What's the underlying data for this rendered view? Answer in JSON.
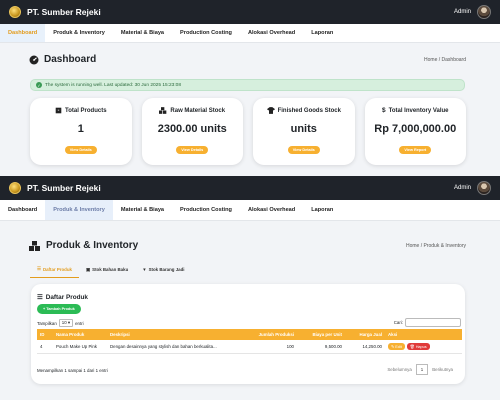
{
  "app": {
    "brand": "PT. Sumber Rejeki",
    "user": "Admin"
  },
  "menu": [
    "Dashboard",
    "Produk & Inventory",
    "Material & Biaya",
    "Production Costing",
    "Alokasi Overhead",
    "Laporan"
  ],
  "dashboard": {
    "title": "Dashboard",
    "breadcrumb": "Home / Dashboard",
    "alert": "The system is running well. Last updated: 30 Jun 2025 15:23:08",
    "cards": [
      {
        "title": "Total Products",
        "value": "1",
        "button": "View Details",
        "icon": "box-icon"
      },
      {
        "title": "Raw Material Stock",
        "value": "2300.00 units",
        "button": "View Details",
        "icon": "cubes-icon"
      },
      {
        "title": "Finished Goods Stock",
        "value": "units",
        "button": "View Details",
        "icon": "shirt-icon"
      },
      {
        "title": "Total Inventory Value",
        "value": "Rp 7,000,000.00",
        "button": "View Report",
        "icon": "dollar-icon"
      }
    ]
  },
  "inventory": {
    "title": "Produk & Inventory",
    "breadcrumb": "Home / Produk & Inventory",
    "tabs": [
      "Daftar Produk",
      "Stok Bahan Baku",
      "Stok Barang Jadi"
    ],
    "list_title": "Daftar Produk",
    "add_button": "+ Tambah Produk",
    "show_label": "Tampilkan",
    "show_value": "10",
    "show_suffix": "entri",
    "search_label": "Cari:",
    "columns": [
      "ID",
      "Nama Produk",
      "Deskripsi",
      "Jumlah Produksi",
      "Biaya per Unit",
      "Harga Jual",
      "Aksi"
    ],
    "rows": [
      {
        "id": "4",
        "name": "Pouch Make Up Pink",
        "desc": "Dengan desainnya yang stylish dan bahan berkualita...",
        "qty": "100",
        "cost": "9,500.00",
        "price": "14,250.00",
        "edit": "Edit",
        "delete": "Hapus"
      }
    ],
    "info": "Menampilkan 1 sampai 1 dari 1 entri",
    "prev": "Sebelumnya",
    "page": "1",
    "next": "Berikutnya"
  }
}
